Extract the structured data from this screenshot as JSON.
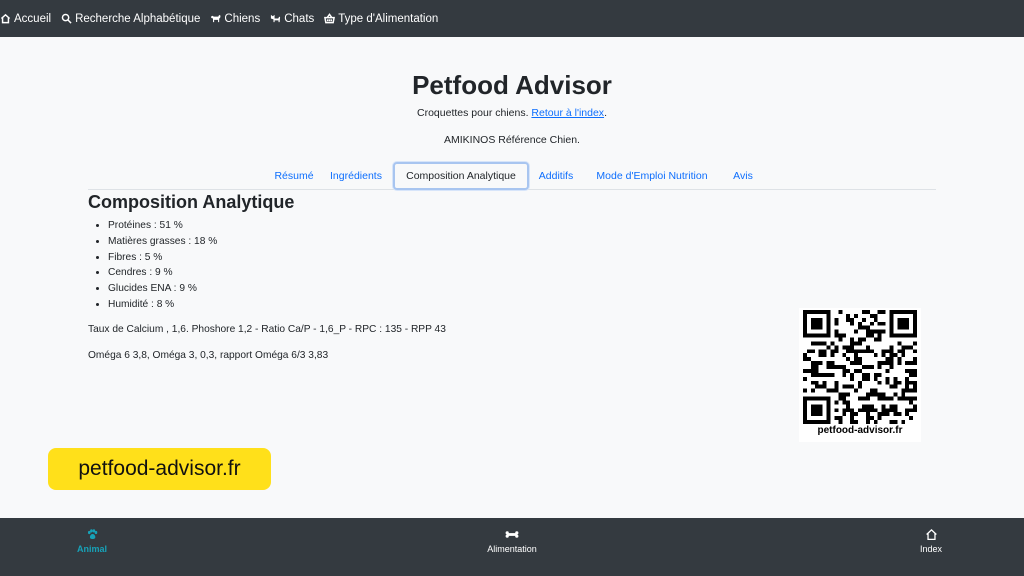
{
  "topnav": {
    "items": [
      {
        "label": "Accueil",
        "icon": "home-icon"
      },
      {
        "label": "Recherche Alphabétique",
        "icon": "search-icon"
      },
      {
        "label": "Chiens",
        "icon": "dog-icon"
      },
      {
        "label": "Chats",
        "icon": "cat-icon"
      },
      {
        "label": "Type d'Alimentation",
        "icon": "basket-icon"
      }
    ]
  },
  "header": {
    "title": "Petfood Advisor",
    "subtitle_prefix": "Croquettes pour chiens. ",
    "back_link": "Retour à l'index",
    "subtitle_suffix": ".",
    "reference": "AMIKINOS Référence Chien."
  },
  "tabs": [
    {
      "label": "Résumé",
      "active": false
    },
    {
      "label": "Ingrédients",
      "active": false
    },
    {
      "label": "Composition Analytique",
      "active": true
    },
    {
      "label": "Additifs",
      "active": false
    },
    {
      "label": "Mode d'Emploi Nutrition",
      "active": false
    },
    {
      "label": "Avis",
      "active": false
    }
  ],
  "content": {
    "section_title": "Composition Analytique",
    "composition": [
      "Protéines : 51 %",
      "Matières grasses : 18 %",
      "Fibres : 5 %",
      "Cendres : 9 %",
      "Glucides ENA : 9 %",
      "Humidité : 8 %"
    ],
    "calcium_line": "Taux de Calcium , 1,6. Phoshore 1,2 - Ratio Ca/P - 1,6_P - RPC : 135 - RPP 43",
    "omega_line": "Oméga 6 3,8, Oméga 3, 0,3, rapport Oméga 6/3 3,83"
  },
  "qr": {
    "label": "petfood-advisor.fr"
  },
  "watermark": {
    "text": "petfood-advisor.fr",
    "color": "#ffe01a"
  },
  "bottomnav": {
    "items": [
      {
        "label": "Animal",
        "icon": "paw-icon",
        "active": true
      },
      {
        "label": "Alimentation",
        "icon": "bone-icon",
        "active": false
      },
      {
        "label": "Index",
        "icon": "home-icon",
        "active": false
      }
    ]
  },
  "colors": {
    "navbar": "#343a40",
    "link": "#0d6efd",
    "active_bottom": "#17a2b8",
    "background": "#f8f9fa"
  }
}
